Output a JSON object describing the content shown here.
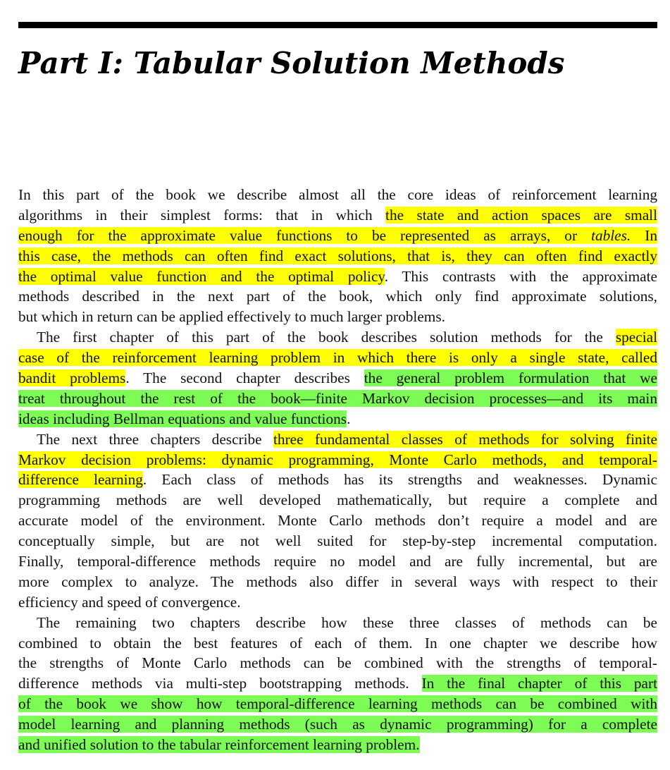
{
  "part_title": "Part I: Tabular Solution Methods",
  "highlight_colors": {
    "yellow": "#ffff00",
    "green": "#7cfc55"
  },
  "p1": {
    "l1": "In this part of the book we describe almost all the core ideas of reinforcement learning",
    "l2a": "algorithms in their simplest forms: that in which ",
    "l2b": "the state and action spaces are small",
    "l3a": "enough for the approximate value functions to be represented as arrays, or ",
    "l3b": "tables.",
    "l3c": " In",
    "l4": "this case, the methods can often find exact solutions, that is, they can often find exactly",
    "l5a": "the optimal value function and the optimal policy",
    "l5b": ". This contrasts with the approximate",
    "l6": "methods described in the next part of the book, which only find approximate solutions,",
    "l7": "but which in return can be applied effectively to much larger problems."
  },
  "p2": {
    "l1a": "The first chapter of this part of the book describes solution methods for the ",
    "l1b": "special",
    "l2": "case of the reinforcement learning problem in which there is only a single state, called",
    "l3a": "bandit problems",
    "l3b": ". The second chapter describes ",
    "l3c": "the general problem formulation that we",
    "l4": "treat throughout the rest of the book—finite Markov decision processes—and its main",
    "l5a": "ideas including Bellman equations and value functions",
    "l5b": "."
  },
  "p3": {
    "l1a": "The next three chapters describe ",
    "l1b": "three fundamental classes of methods for solving finite",
    "l2": "Markov decision problems: dynamic programming, Monte Carlo methods, and temporal-",
    "l3a": "difference learning",
    "l3b": ". Each class of methods has its strengths and weaknesses. Dynamic",
    "l4": "programming methods are well developed mathematically, but require a complete and",
    "l5": "accurate model of the environment. Monte Carlo methods don’t require a model and are",
    "l6": "conceptually simple, but are not well suited for step-by-step incremental computation.",
    "l7": "Finally, temporal-difference methods require no model and are fully incremental, but are",
    "l8": "more complex to analyze. The methods also differ in several ways with respect to their",
    "l9": "efficiency and speed of convergence."
  },
  "p4": {
    "l1": "The remaining two chapters describe how these three classes of methods can be",
    "l2": "combined to obtain the best features of each of them. In one chapter we describe how",
    "l3": "the strengths of Monte Carlo methods can be combined with the strengths of temporal-",
    "l4a": "difference methods via multi-step bootstrapping methods. ",
    "l4b": "In the final chapter of this part",
    "l5": "of the book we show how temporal-difference learning methods can be combined with",
    "l6": "model learning and planning methods (such as dynamic programming) for a complete",
    "l7": "and unified solution to the tabular reinforcement learning problem."
  }
}
